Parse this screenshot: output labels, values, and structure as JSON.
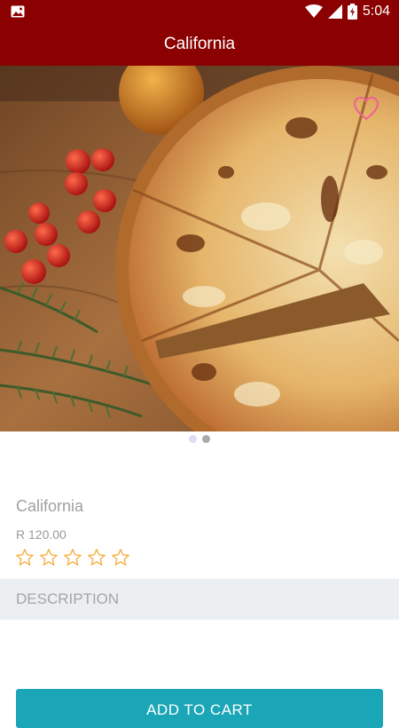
{
  "status_bar": {
    "time": "5:04"
  },
  "app_bar": {
    "title": "California"
  },
  "product": {
    "name": "California",
    "price": "R 120.00",
    "rating": 0,
    "rating_max": 5
  },
  "carousel": {
    "pages": 2,
    "current": 2
  },
  "description": {
    "header": "DESCRIPTION"
  },
  "actions": {
    "add_to_cart": "ADD TO CART"
  },
  "colors": {
    "primary": "#8b0000",
    "accent": "#1aa6b7",
    "star": "#f5b041",
    "favorite": "#f06292"
  },
  "icons": {
    "favorite": "heart-outline-icon",
    "rating": "star-outline-icon"
  }
}
